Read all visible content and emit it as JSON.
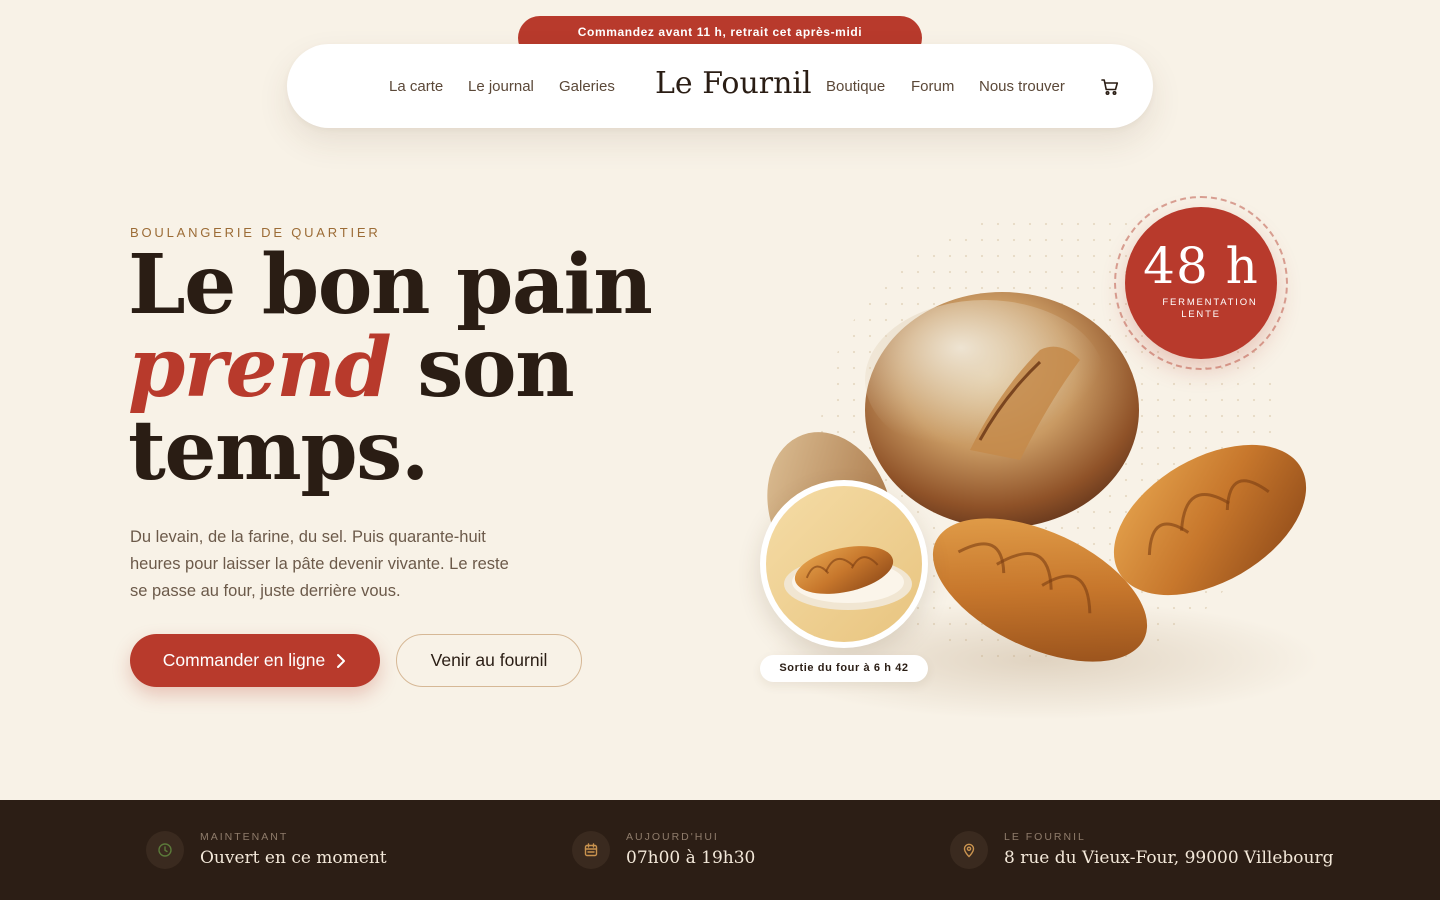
{
  "promo": {
    "text": "Commandez avant 11 h, retrait cet après-midi"
  },
  "nav": {
    "left_links": [
      "La carte",
      "Le journal",
      "Galeries"
    ],
    "brand": "Le Fournil",
    "right_links": [
      "Boutique",
      "Forum",
      "Nous trouver"
    ],
    "cart_icon": "cart-icon"
  },
  "hero": {
    "eyebrow": "BOULANGERIE DE QUARTIER",
    "headline_line1": "Le bon pain",
    "headline_accent": "prend",
    "headline_line2_rest": " son",
    "headline_line3": "temps.",
    "lede": "Du levain, de la farine, du sel. Puis quarante-huit heures pour laisser la pâte devenir vivante. Le reste se passe au four, juste derrière vous.",
    "primary_cta": "Commander en ligne",
    "secondary_cta": "Venir au fournil"
  },
  "badge": {
    "number": "48 h",
    "caption_line1": "FERMENTATION",
    "caption_line2": "LENTE"
  },
  "thumb": {
    "caption": "Sortie du four à 6 h 42"
  },
  "info_strip": [
    {
      "icon": "clock-icon",
      "label": "MAINTENANT",
      "value": "Ouvert en ce moment"
    },
    {
      "icon": "calendar-icon",
      "label": "AUJOURD'HUI",
      "value": "07h00 à 19h30"
    },
    {
      "icon": "location-pin-icon",
      "label": "LE FOURNIL",
      "value": "8 rue du Vieux-Four, 99000 Villebourg"
    }
  ],
  "colors": {
    "background": "#f8f2e7",
    "accent": "#b83a2c",
    "dark": "#2c1e15",
    "eyebrow": "#9c6c36",
    "open_status": "#5b7a3a"
  }
}
